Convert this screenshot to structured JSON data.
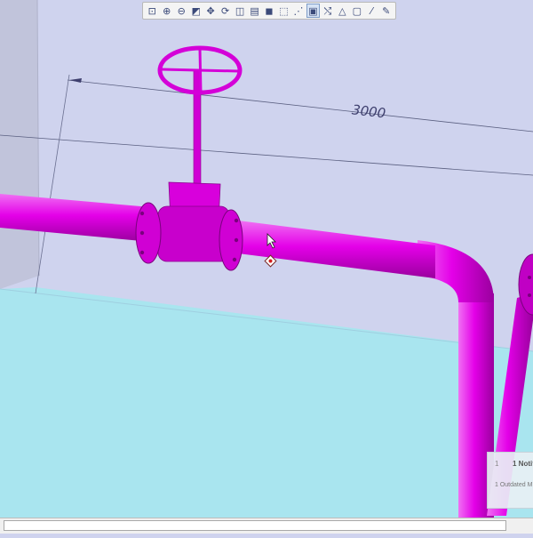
{
  "toolbar": {
    "buttons": [
      {
        "name": "zoom-fit-button",
        "glyph": "⊡"
      },
      {
        "name": "zoom-in-button",
        "glyph": "⊕"
      },
      {
        "name": "zoom-out-button",
        "glyph": "⊖"
      },
      {
        "name": "zoom-window-button",
        "glyph": "◩"
      },
      {
        "name": "pan-button",
        "glyph": "✥"
      },
      {
        "name": "rotate-view-button",
        "glyph": "⟳"
      },
      {
        "name": "orient-button",
        "glyph": "◫"
      },
      {
        "name": "saved-views-button",
        "glyph": "▤"
      },
      {
        "name": "display-style-button",
        "glyph": "◼"
      },
      {
        "name": "section-view-button",
        "glyph": "⬚"
      },
      {
        "name": "datum-display-button",
        "glyph": "⋰"
      },
      {
        "name": "selection-button",
        "glyph": "▣"
      },
      {
        "name": "axis-display-button",
        "glyph": "⤭"
      },
      {
        "name": "csys-display-button",
        "glyph": "△"
      },
      {
        "name": "annotation-display-button",
        "glyph": "▢"
      },
      {
        "name": "spin-center-button",
        "glyph": "⁄"
      },
      {
        "name": "render-button",
        "glyph": "✎"
      }
    ],
    "active_index": 11
  },
  "dimension": {
    "value": "3000"
  },
  "notification": {
    "marker": "1",
    "title": "1 Notif",
    "subtitle": "1 Outdated M"
  },
  "colors": {
    "pipe": "#e400e8",
    "pipe_shade": "#b800bc",
    "pipe_dark": "#8a008e",
    "floor": "#a9e5ef",
    "background": "#cfd3ee",
    "wall": "#c1c4db"
  }
}
